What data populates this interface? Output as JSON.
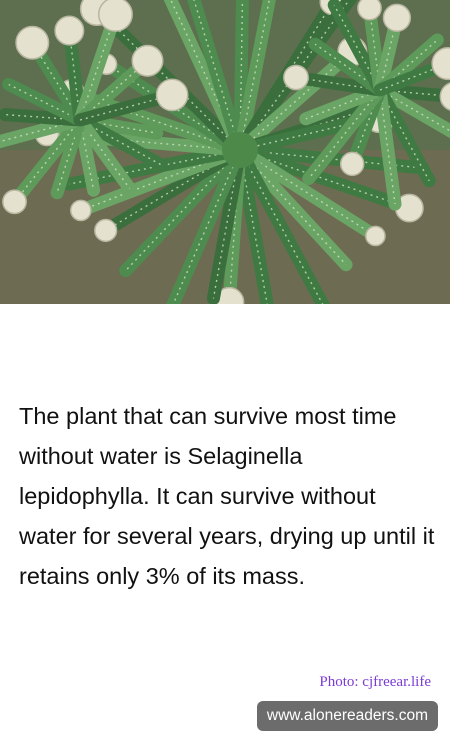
{
  "image": {
    "subject": "selaginella-lepidophylla-plant"
  },
  "fact": {
    "text": "The plant that can survive most time without water is Selaginella lepidophylla. It can survive without water for several years, drying up until it retains only 3% of its mass."
  },
  "credit": {
    "text": "Photo: cjfreear.life"
  },
  "site": {
    "label": "www.alonereaders.com"
  },
  "colors": {
    "background": "#ffffff",
    "text": "#111111",
    "credit": "#7a3bd6",
    "badge_background": "#6c6c6c",
    "badge_text": "#ffffff"
  }
}
